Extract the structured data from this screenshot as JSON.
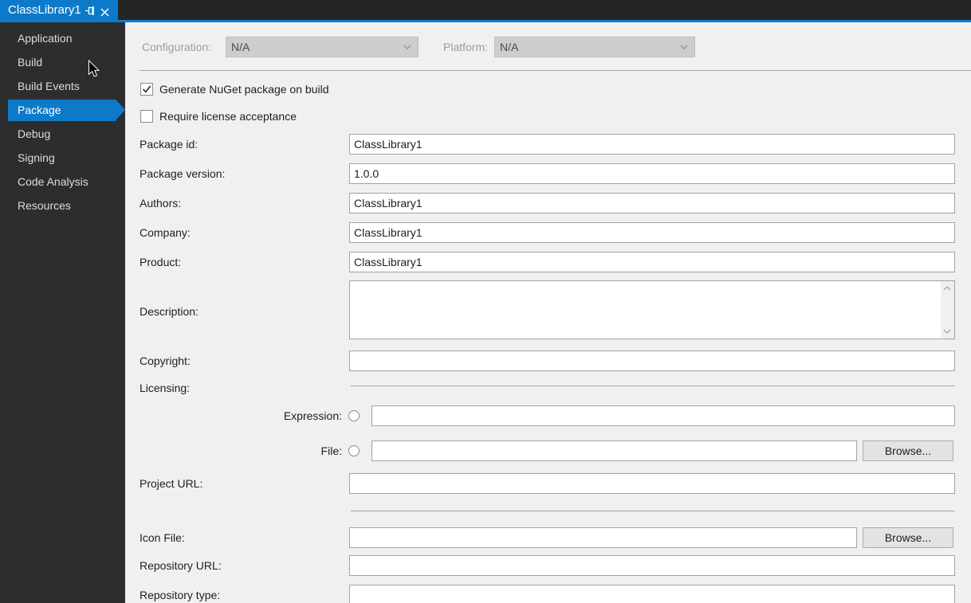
{
  "tab": {
    "title": "ClassLibrary1"
  },
  "sidebar": {
    "items": [
      {
        "label": "Application",
        "selected": false
      },
      {
        "label": "Build",
        "selected": false
      },
      {
        "label": "Build Events",
        "selected": false
      },
      {
        "label": "Package",
        "selected": true
      },
      {
        "label": "Debug",
        "selected": false
      },
      {
        "label": "Signing",
        "selected": false
      },
      {
        "label": "Code Analysis",
        "selected": false
      },
      {
        "label": "Resources",
        "selected": false
      }
    ]
  },
  "toolbar": {
    "configuration_label": "Configuration:",
    "configuration_value": "N/A",
    "platform_label": "Platform:",
    "platform_value": "N/A"
  },
  "checkboxes": {
    "generate_nuget": {
      "label": "Generate NuGet package on build",
      "checked": true
    },
    "require_license": {
      "label": "Require license acceptance",
      "checked": false
    }
  },
  "fields": {
    "package_id": {
      "label": "Package id:",
      "value": "ClassLibrary1"
    },
    "package_version": {
      "label": "Package version:",
      "value": "1.0.0"
    },
    "authors": {
      "label": "Authors:",
      "value": "ClassLibrary1"
    },
    "company": {
      "label": "Company:",
      "value": "ClassLibrary1"
    },
    "product": {
      "label": "Product:",
      "value": "ClassLibrary1"
    },
    "description": {
      "label": "Description:",
      "value": ""
    },
    "copyright": {
      "label": "Copyright:",
      "value": ""
    },
    "licensing": {
      "label": "Licensing:"
    },
    "expression": {
      "label": "Expression:",
      "value": ""
    },
    "file": {
      "label": "File:",
      "value": ""
    },
    "project_url": {
      "label": "Project URL:",
      "value": ""
    },
    "icon_file": {
      "label": "Icon File:",
      "value": ""
    },
    "repository_url": {
      "label": "Repository URL:",
      "value": ""
    },
    "repository_type": {
      "label": "Repository type:",
      "value": ""
    }
  },
  "buttons": {
    "browse": "Browse..."
  },
  "colors": {
    "accent_blue": "#0d7ac9",
    "sidebar_bg": "#2d2d30",
    "tabstrip_bg": "#252526",
    "main_bg": "#f0f0f0"
  }
}
